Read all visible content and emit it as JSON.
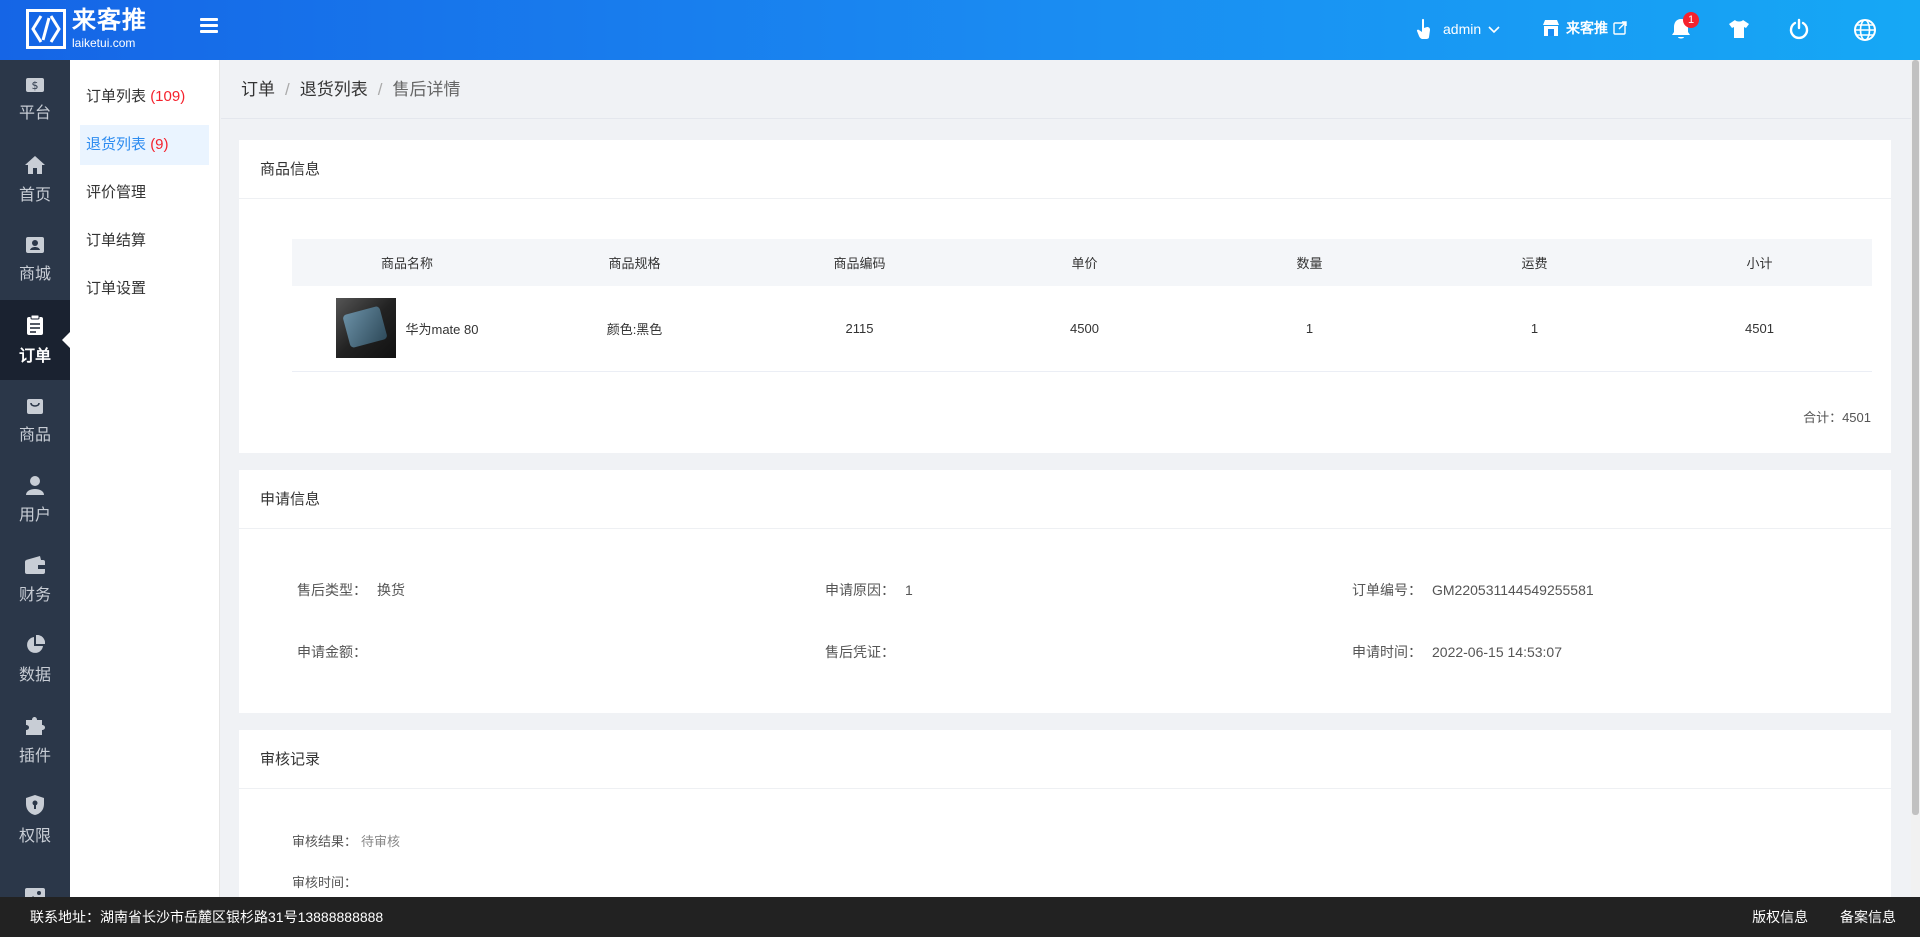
{
  "header": {
    "logo_name": "来客推",
    "logo_domain": "laiketui.com",
    "user_name": "admin",
    "store_name": "来客推",
    "notification_count": "1"
  },
  "nav": {
    "items": [
      {
        "label": "平台",
        "icon": "dollar-icon"
      },
      {
        "label": "首页",
        "icon": "home-icon"
      },
      {
        "label": "商城",
        "icon": "store-icon"
      },
      {
        "label": "订单",
        "icon": "clipboard-icon",
        "active": true
      },
      {
        "label": "商品",
        "icon": "bag-icon"
      },
      {
        "label": "用户",
        "icon": "user-icon"
      },
      {
        "label": "财务",
        "icon": "wallet-icon"
      },
      {
        "label": "数据",
        "icon": "pie-chart-icon"
      },
      {
        "label": "插件",
        "icon": "puzzle-icon"
      },
      {
        "label": "权限",
        "icon": "shield-icon"
      },
      {
        "label": "",
        "icon": "image-icon"
      }
    ]
  },
  "subnav": {
    "items": [
      {
        "label": "订单列表",
        "count": "(109)"
      },
      {
        "label": "退货列表",
        "count": "(9)",
        "active": true
      },
      {
        "label": "评价管理",
        "count": ""
      },
      {
        "label": "订单结算",
        "count": ""
      },
      {
        "label": "订单设置",
        "count": ""
      }
    ]
  },
  "breadcrumb": [
    "订单",
    "退货列表",
    "售后详情"
  ],
  "goods": {
    "title": "商品信息",
    "columns": [
      "商品名称",
      "商品规格",
      "商品编码",
      "单价",
      "数量",
      "运费",
      "小计"
    ],
    "rows": [
      {
        "name": "华为mate 80",
        "spec": "颜色:黑色",
        "code": "2115",
        "price": "4500",
        "qty": "1",
        "shipping": "1",
        "subtotal": "4501"
      }
    ],
    "total_label": "合计：",
    "total_value": "4501"
  },
  "apply": {
    "title": "申请信息",
    "type_label": "售后类型：",
    "type_value": "换货",
    "reason_label": "申请原因：",
    "reason_value": "1",
    "order_no_label": "订单编号：",
    "order_no_value": "GM220531144549255581",
    "amount_label": "申请金额：",
    "amount_value": "",
    "proof_label": "售后凭证：",
    "proof_value": "",
    "time_label": "申请时间：",
    "time_value": "2022-06-15 14:53:07"
  },
  "audit": {
    "title": "审核记录",
    "result_label": "审核结果：",
    "result_value": "待审核",
    "time_label": "审核时间：",
    "time_value": ""
  },
  "footer": {
    "address": "联系地址：湖南省长沙市岳麓区银杉路31号13888888888",
    "copyright": "版权信息",
    "icp": "备案信息"
  }
}
